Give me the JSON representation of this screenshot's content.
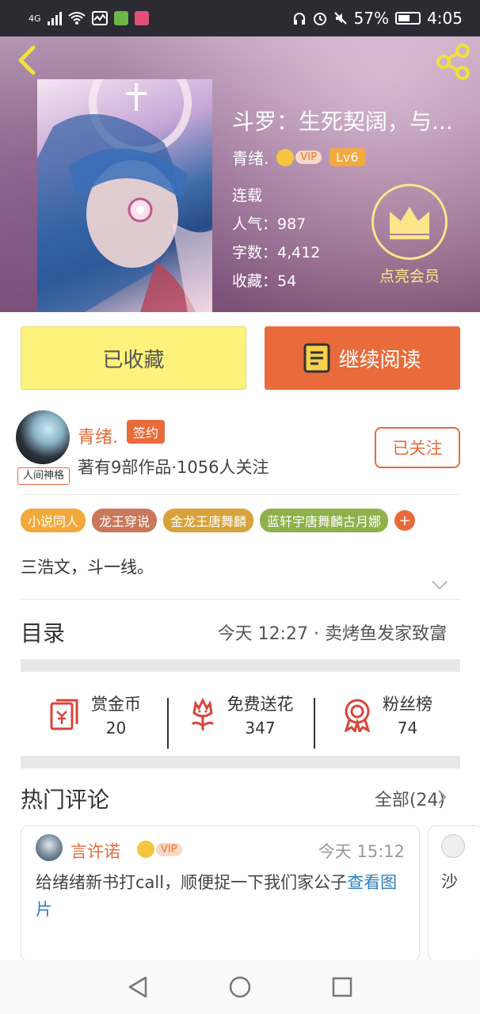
{
  "status_bar": {
    "network": "4G",
    "battery": "57%",
    "time": "4:05"
  },
  "book": {
    "title": "斗罗：生死契阔，与...",
    "author": "青绪.",
    "vip_label": "VIP",
    "level": "Lv6",
    "status": "连载",
    "popularity_label": "人气：987",
    "word_count_label": "字数：4,412",
    "favorites_label": "收藏：54",
    "member_label": "点亮会员"
  },
  "actions": {
    "collected_label": "已收藏",
    "continue_label": "继续阅读"
  },
  "author_panel": {
    "name": "青绪.",
    "badge": "人间神格",
    "sign_label": "签约",
    "stats": "著有9部作品·1056人关注",
    "follow_label": "已关注"
  },
  "tags": [
    {
      "label": "小说同人",
      "color": "#f2a93b"
    },
    {
      "label": "龙王穿说",
      "color": "#c9785a"
    },
    {
      "label": "金龙王唐舞麟",
      "color": "#d7a23a"
    },
    {
      "label": "蓝轩宇唐舞麟古月娜",
      "color": "#8fb04a"
    }
  ],
  "tag_more": "+",
  "intro": "三浩文，斗一线。",
  "toc": {
    "label": "目录",
    "latest": "今天 12:27 · 卖烤鱼发家致富"
  },
  "stats": [
    {
      "name": "赏金币",
      "value": "20",
      "icon": "red-envelope-icon"
    },
    {
      "name": "免费送花",
      "value": "347",
      "icon": "flower-icon"
    },
    {
      "name": "粉丝榜",
      "value": "74",
      "icon": "medal-icon"
    }
  ],
  "hot_comments": {
    "title": "热门评论",
    "all_label": "全部(24)"
  },
  "comment": {
    "user": "言许诺",
    "vip": "VIP",
    "time": "今天 15:12",
    "text": "给绪绪新书打call，顺便捉一下我们家公子",
    "link": "查看图片"
  },
  "comment2": {
    "text": "沙"
  },
  "colors": {
    "accent": "#e96a3a",
    "fav_button": "#fdf27c",
    "crown": "#ffe58a"
  }
}
